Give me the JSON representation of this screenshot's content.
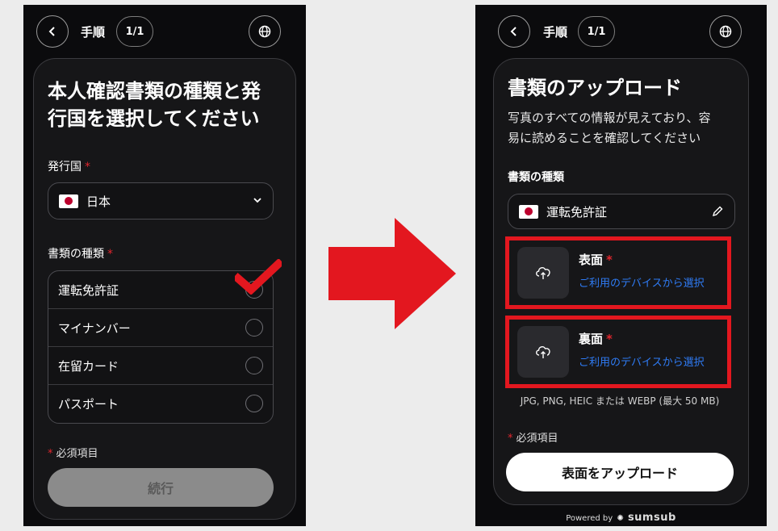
{
  "left": {
    "step_label": "手順",
    "step_count": "1/1",
    "title_line1": "本人確認書類の種類と発",
    "title_line2": "行国を選択してください",
    "country_label": "発行国",
    "country_value": "日本",
    "doc_type_label": "書類の種類",
    "options": [
      "運転免許証",
      "マイナンバー",
      "在留カード",
      "パスポート"
    ],
    "required_note": "必須項目",
    "continue_button": "続行"
  },
  "right": {
    "step_label": "手順",
    "step_count": "1/1",
    "title": "書類のアップロード",
    "subtitle_line1": "写真のすべての情報が見えており、容",
    "subtitle_line2": "易に読めることを確認してください",
    "doc_type_label": "書類の種類",
    "doc_type_value": "運転免許証",
    "front_label": "表面",
    "back_label": "裏面",
    "upload_link": "ご利用のデバイスから選択",
    "formats": "JPG, PNG, HEIC または WEBP (最大 50 MB)",
    "required_note": "必須項目",
    "upload_button": "表面をアップロード",
    "powered_by": "Powered by",
    "brand": "sumsub"
  },
  "colors": {
    "accent_red": "#e3171f",
    "link_blue": "#2f7cf6",
    "background_dark": "#0b0b0d"
  },
  "icons": [
    "chevron-left-icon",
    "globe-icon",
    "chevron-down-icon",
    "checkmark-icon",
    "upload-cloud-icon",
    "pencil-icon",
    "arrow-right-icon"
  ]
}
